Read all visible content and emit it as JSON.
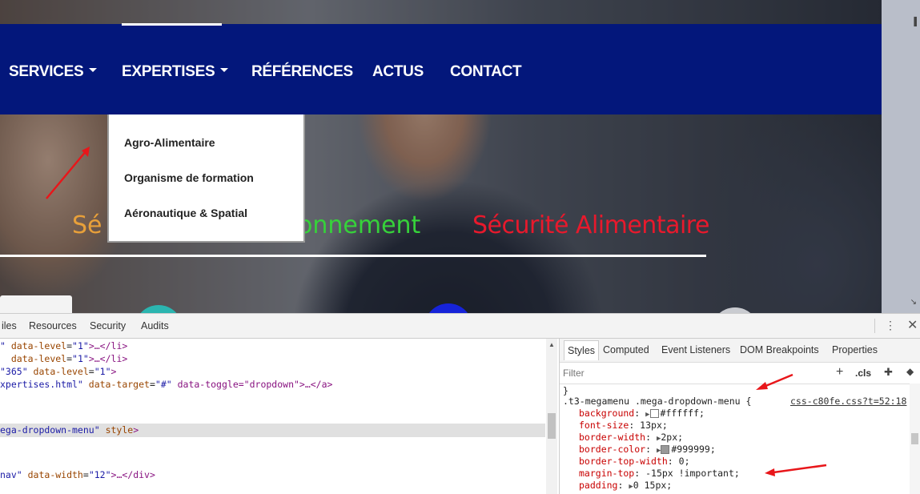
{
  "website": {
    "nav": {
      "items": [
        {
          "label": "SERVICES",
          "has_caret": true
        },
        {
          "label": "EXPERTISES",
          "has_caret": true
        },
        {
          "label": "RÉFÉRENCES",
          "has_caret": false
        },
        {
          "label": "ACTUS",
          "has_caret": false
        },
        {
          "label": "CONTACT",
          "has_caret": false
        }
      ],
      "background_color": "#03177b"
    },
    "dropdown": {
      "items": [
        "Agro-Alimentaire",
        "Organisme de formation",
        "Aéronautique & Spatial"
      ]
    },
    "tagline": {
      "part1": "Sé",
      "part2": "onnement",
      "part3": "Sécurité Alimentaire"
    },
    "annotation_color": "#e8161a"
  },
  "devtools": {
    "tabs": [
      "iles",
      "Resources",
      "Security",
      "Audits"
    ],
    "elements_lines": [
      {
        "a": "\" ",
        "attr": "data-level",
        "val": "\"1\"",
        "rest": ">…</li>"
      },
      {
        "a": "  ",
        "attr": "data-level",
        "val": "\"1\"",
        "rest": ">…</li>"
      },
      {
        "a": "\"365\" ",
        "attr": "data-level",
        "val": "\"1\"",
        "rest": ">"
      },
      {
        "a": "xpertises.html\" ",
        "attr": "data-target",
        "val": "\"#\"",
        "rest": " data-toggle=\"dropdown\">…</a>"
      },
      {
        "a": "ega-dropdown-menu\" ",
        "attr": "style",
        "val": "",
        "rest": ">"
      },
      {
        "a": "nav\" ",
        "attr": "data-width",
        "val": "\"12\"",
        "rest": ">…</div>"
      }
    ],
    "sub_tabs": [
      "Styles",
      "Computed",
      "Event Listeners",
      "DOM Breakpoints",
      "Properties"
    ],
    "filter_placeholder": "Filter",
    "cls_label": ".cls",
    "rule": {
      "selector": ".t3-megamenu .mega-dropdown-menu {",
      "source": "css-c80fe.css?t=52:18",
      "declarations": [
        {
          "name": "background",
          "value": "#ffffff;",
          "swatch": "#ffffff",
          "expandable": true
        },
        {
          "name": "font-size",
          "value": "13px;"
        },
        {
          "name": "border-width",
          "value": "2px;",
          "expandable": true
        },
        {
          "name": "border-color",
          "value": "#999999;",
          "swatch": "#999999",
          "expandable": true
        },
        {
          "name": "border-top-width",
          "value": "0;"
        },
        {
          "name": "margin-top",
          "value": "-15px !important;"
        },
        {
          "name": "padding",
          "value": "0 15px;",
          "expandable": true
        }
      ]
    }
  }
}
